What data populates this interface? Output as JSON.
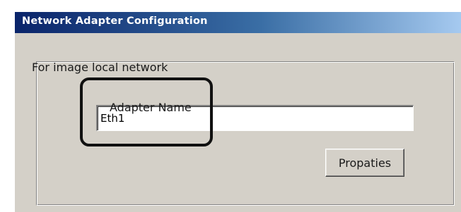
{
  "window": {
    "title": "Network Adapter Configuration"
  },
  "group": {
    "label": "For image local network"
  },
  "adapter": {
    "label": "Adapter Name",
    "value": "Eth1"
  },
  "buttons": {
    "properties_label": "Propaties"
  },
  "colors": {
    "titlebar_start": "#0a246a",
    "titlebar_end": "#a6caf0",
    "dialog_face": "#d4d0c8",
    "highlight_frame": "#111111"
  }
}
